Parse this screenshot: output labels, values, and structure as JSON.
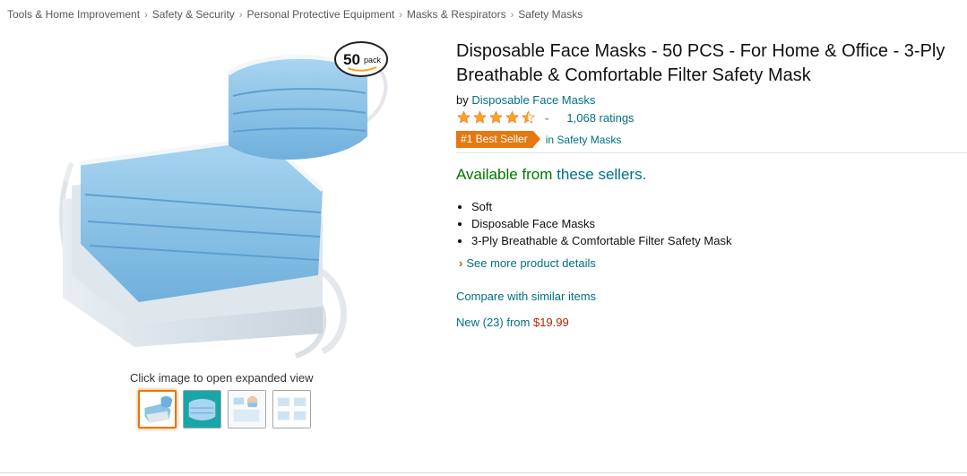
{
  "breadcrumb": [
    "Tools & Home Improvement",
    "Safety & Security",
    "Personal Protective Equipment",
    "Masks & Respirators",
    "Safety Masks"
  ],
  "breadcrumb_separator": "›",
  "image": {
    "caption": "Click image to open expanded view",
    "pack_badge_number": "50",
    "pack_badge_word": "pack",
    "thumbnail_count": 4,
    "active_thumbnail": 0
  },
  "product": {
    "title": "Disposable Face Masks - 50 PCS - For Home & Office - 3-Ply Breathable & Comfortable Filter Safety Mask",
    "by_prefix": "by",
    "brand": "Disposable Face Masks",
    "rating": 4.5,
    "rating_icon": "chevron-down-icon",
    "ratings_text": "1,068 ratings",
    "best_seller_badge": "#1 Best Seller",
    "best_seller_category": "in Safety Masks"
  },
  "availability": {
    "prefix": "Available from ",
    "link": "these sellers."
  },
  "bullets": [
    "Soft",
    "Disposable Face Masks",
    "3-Ply Breathable & Comfortable Filter Safety Mask"
  ],
  "links": {
    "see_more": "See more product details",
    "compare": "Compare with similar items",
    "new_offers": "New (23) from ",
    "new_price": "$19.99"
  },
  "colors": {
    "link": "#007185",
    "availability": "#007600",
    "badge": "#e47911",
    "price": "#b12704",
    "star": "#ffa41c",
    "mask_blue": "#8cc3e6"
  }
}
